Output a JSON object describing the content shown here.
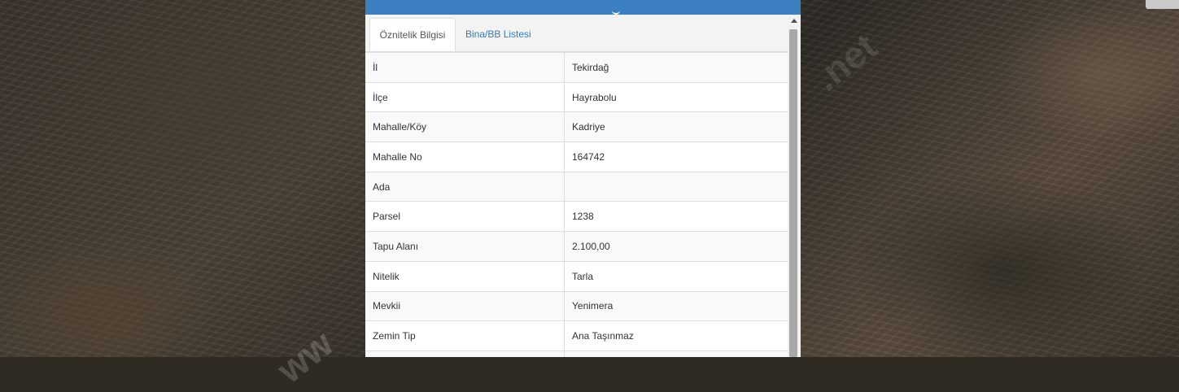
{
  "tabs": {
    "attribute_info": "Öznitelik Bilgisi",
    "building_list": "Bina/BB Listesi"
  },
  "attributes": [
    {
      "key": "İl",
      "value": "Tekirdağ"
    },
    {
      "key": "İlçe",
      "value": "Hayrabolu"
    },
    {
      "key": "Mahalle/Köy",
      "value": "Kadriye"
    },
    {
      "key": "Mahalle No",
      "value": "164742"
    },
    {
      "key": "Ada",
      "value": ""
    },
    {
      "key": "Parsel",
      "value": "1238"
    },
    {
      "key": "Tapu Alanı",
      "value": "2.100,00"
    },
    {
      "key": "Nitelik",
      "value": "Tarla"
    },
    {
      "key": "Mevkii",
      "value": "Yenimera"
    },
    {
      "key": "Zemin Tip",
      "value": "Ana Taşınmaz"
    },
    {
      "key": "",
      "value": ""
    }
  ],
  "colors": {
    "header": "#3c7fc1",
    "tab_link": "#337ab7"
  },
  "icons": {
    "scroll_up": "scroll-up-arrow-icon"
  }
}
